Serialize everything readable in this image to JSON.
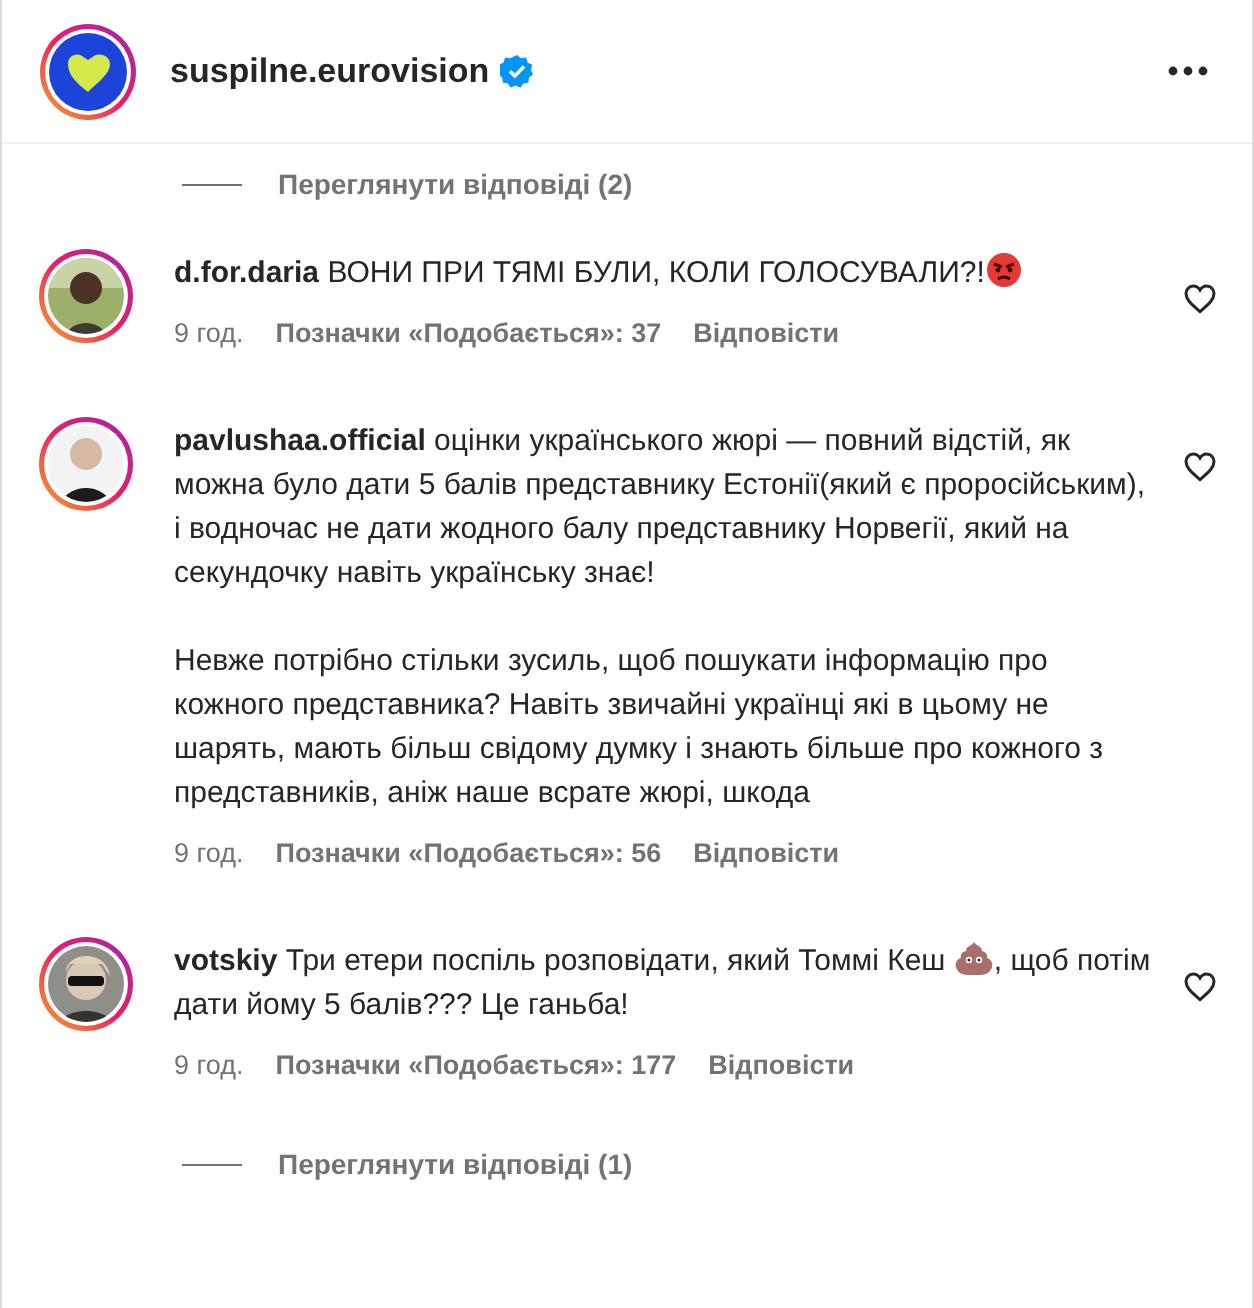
{
  "header": {
    "username": "suspilne.eurovision",
    "verified": true
  },
  "items": [
    {
      "kind": "replies",
      "label": "Переглянути відповіді (2)"
    },
    {
      "kind": "comment",
      "username": "d.for.daria",
      "segments": [
        {
          "kind": "text",
          "text": "ВОНИ ПРИ ТЯМІ БУЛИ, КОЛИ ГОЛОСУВАЛИ?!"
        },
        {
          "kind": "angry"
        }
      ],
      "time": "9 год.",
      "likes": "Позначки «Подобається»: 37",
      "reply": "Відповісти"
    },
    {
      "kind": "comment",
      "username": "pavlushaa.official",
      "segments": [
        {
          "kind": "text",
          "text": "оцінки українського жюрі — повний відстій, як можна було дати 5 балів представнику Естонії(який є проросійським), і водночас не дати жодного балу представнику Норвегії, який на секундочку навіть українську знає!"
        }
      ],
      "paragraphs": [
        "Невже потрібно стільки зусиль, щоб пошукати інформацію про кожного представника? Навіть звичайні українці які в цьому не шарять, мають більш свідому думку і знають більше про кожного з представників, аніж наше всрате жюрі, шкода"
      ],
      "time": "9 год.",
      "likes": "Позначки «Подобається»: 56",
      "reply": "Відповісти"
    },
    {
      "kind": "comment",
      "username": "votskiy",
      "segments": [
        {
          "kind": "text",
          "text": "Три етери поспіль розповідати, який Томмі Кеш "
        },
        {
          "kind": "poo"
        },
        {
          "kind": "text",
          "text": ", щоб потім дати йому 5 балів??? Це ганьба!"
        }
      ],
      "time": "9 год.",
      "likes": "Позначки «Подобається»: 177",
      "reply": "Відповісти"
    },
    {
      "kind": "replies",
      "label": "Переглянути відповіді (1)"
    }
  ]
}
